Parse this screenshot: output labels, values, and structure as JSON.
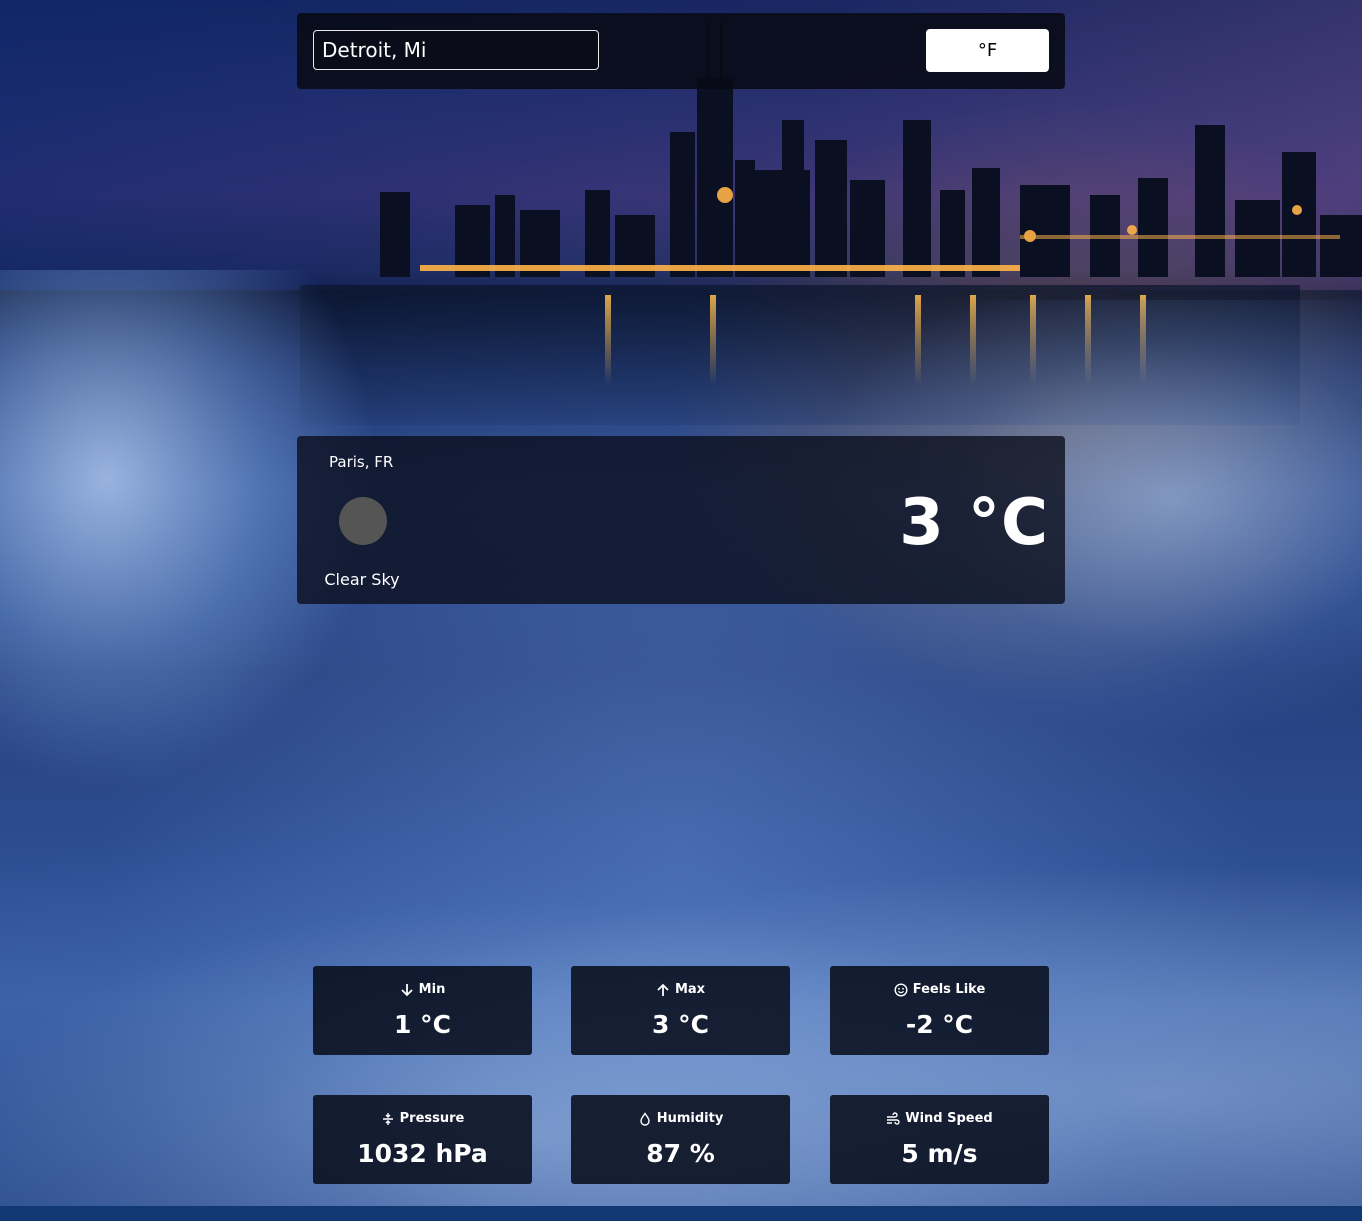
{
  "search": {
    "value": "Detroit, Mi"
  },
  "unit_toggle": {
    "label": "°F"
  },
  "current": {
    "location": "Paris, FR",
    "condition": "Clear Sky",
    "temperature": "3 °C"
  },
  "stats": [
    {
      "icon": "arrow-down-icon",
      "label": "Min",
      "value": "1 °C"
    },
    {
      "icon": "arrow-up-icon",
      "label": "Max",
      "value": "3 °C"
    },
    {
      "icon": "smile-icon",
      "label": "Feels Like",
      "value": "-2 °C"
    },
    {
      "icon": "pressure-icon",
      "label": "Pressure",
      "value": "1032 hPa"
    },
    {
      "icon": "droplet-icon",
      "label": "Humidity",
      "value": "87 %"
    },
    {
      "icon": "wind-icon",
      "label": "Wind Speed",
      "value": "5 m/s"
    }
  ],
  "colors": {
    "card_background": "#0a0d1a",
    "unit_button_background": "#ffffff",
    "weather_icon_placeholder": "#555555"
  }
}
